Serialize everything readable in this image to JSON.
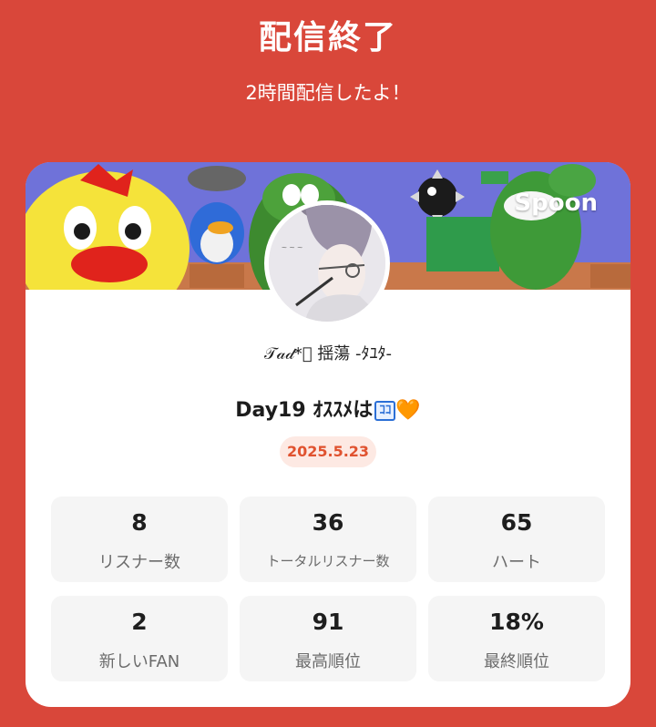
{
  "header": {
    "title": "配信終了",
    "subtitle": "2時間配信したよ！"
  },
  "card": {
    "brand": "Spoon",
    "username": "𝒯𝒶𝒹*ﾟ 揺蕩 -ﾀﾕﾀ-",
    "live_title": "Day19 ｵｽｽﾒは",
    "live_title_emoji": "ｺｺ",
    "live_title_heart": "🧡",
    "date": "2025.5.23"
  },
  "stats": [
    {
      "value": "8",
      "label": "リスナー数"
    },
    {
      "value": "36",
      "label": "トータルリスナー数"
    },
    {
      "value": "65",
      "label": "ハート"
    },
    {
      "value": "2",
      "label": "新しいFAN"
    },
    {
      "value": "91",
      "label": "最高順位"
    },
    {
      "value": "18%",
      "label": "最終順位"
    }
  ],
  "colors": {
    "background": "#d9473a",
    "card": "#ffffff",
    "accent": "#e0522f",
    "stat_bg": "#f5f5f5"
  },
  "icons": {
    "banner": "game-characters-banner",
    "avatar": "user-avatar"
  }
}
